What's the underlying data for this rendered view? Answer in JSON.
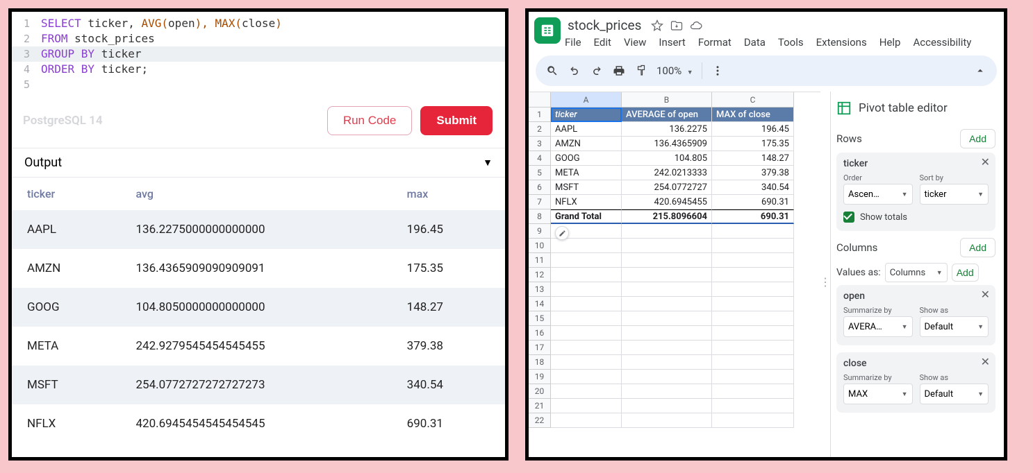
{
  "sql": {
    "lines": [
      {
        "n": "1",
        "kw1": "SELECT",
        "rest": " ticker, ",
        "fn1": "AVG",
        "p1": "(",
        "a1": "open",
        "p2": "), ",
        "fn2": "MAX",
        "p3": "(",
        "a2": "close",
        "p4": ")"
      },
      {
        "n": "2",
        "kw1": "FROM",
        "rest": " stock_prices"
      },
      {
        "n": "3",
        "kw1": "GROUP BY",
        "rest": " ticker",
        "hl": true
      },
      {
        "n": "4",
        "kw1": "ORDER BY",
        "rest": " ticker;"
      },
      {
        "n": "5",
        "kw1": "",
        "rest": ""
      }
    ],
    "db_label": "PostgreSQL 14",
    "run_label": "Run Code",
    "submit_label": "Submit",
    "output_title": "Output",
    "columns": [
      "ticker",
      "avg",
      "max"
    ],
    "rows": [
      {
        "ticker": "AAPL",
        "avg": "136.2275000000000000",
        "max": "196.45"
      },
      {
        "ticker": "AMZN",
        "avg": "136.4365909090909091",
        "max": "175.35"
      },
      {
        "ticker": "GOOG",
        "avg": "104.8050000000000000",
        "max": "148.27"
      },
      {
        "ticker": "META",
        "avg": "242.9279545454545455",
        "max": "379.38"
      },
      {
        "ticker": "MSFT",
        "avg": "254.0772727272727273",
        "max": "340.54"
      },
      {
        "ticker": "NFLX",
        "avg": "420.6945454545454545",
        "max": "690.31"
      }
    ]
  },
  "sheets": {
    "doc_title": "stock_prices",
    "menus": [
      "File",
      "Edit",
      "View",
      "Insert",
      "Format",
      "Data",
      "Tools",
      "Extensions",
      "Help",
      "Accessibility"
    ],
    "zoom": "100%",
    "col_labels": [
      "A",
      "B",
      "C"
    ],
    "pivot_header": [
      "ticker",
      "AVERAGE of open",
      "MAX of close"
    ],
    "pivot_rows": [
      {
        "t": "AAPL",
        "a": "136.2275",
        "m": "196.45"
      },
      {
        "t": "AMZN",
        "a": "136.4365909",
        "m": "175.35"
      },
      {
        "t": "GOOG",
        "a": "104.805",
        "m": "148.27"
      },
      {
        "t": "META",
        "a": "242.0213333",
        "m": "379.38"
      },
      {
        "t": "MSFT",
        "a": "254.0772727",
        "m": "340.54"
      },
      {
        "t": "NFLX",
        "a": "420.6945455",
        "m": "690.31"
      }
    ],
    "grand_total": {
      "label": "Grand Total",
      "a": "215.8096604",
      "m": "690.31"
    },
    "empty_rows": [
      9,
      10,
      11,
      12,
      13,
      14,
      15,
      16,
      17,
      18,
      19,
      20,
      21,
      22
    ],
    "pivot_editor": {
      "title": "Pivot table editor",
      "rows_label": "Rows",
      "columns_label": "Columns",
      "values_as_label": "Values as:",
      "values_as_value": "Columns",
      "add_label": "Add",
      "add_short": "Add",
      "ticker_card": {
        "title": "ticker",
        "order_label": "Order",
        "order_value": "Ascen…",
        "sort_label": "Sort by",
        "sort_value": "ticker",
        "show_totals": "Show totals"
      },
      "open_card": {
        "title": "open",
        "sum_label": "Summarize by",
        "sum_value": "AVERA…",
        "show_label": "Show as",
        "show_value": "Default"
      },
      "close_card": {
        "title": "close",
        "sum_label": "Summarize by",
        "sum_value": "MAX",
        "show_label": "Show as",
        "show_value": "Default"
      }
    }
  }
}
